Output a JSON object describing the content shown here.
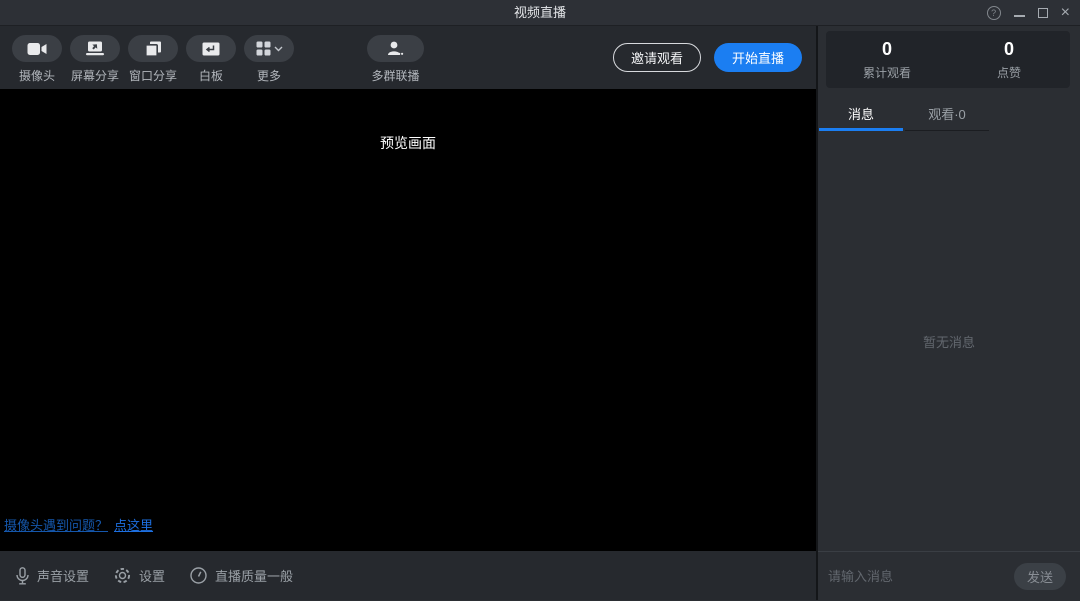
{
  "window": {
    "title": "视频直播"
  },
  "toolbar": {
    "tools": [
      {
        "label": "摄像头",
        "icon": "camera-icon"
      },
      {
        "label": "屏幕分享",
        "icon": "screen-share-icon"
      },
      {
        "label": "窗口分享",
        "icon": "window-share-icon"
      },
      {
        "label": "白板",
        "icon": "whiteboard-icon"
      },
      {
        "label": "更多",
        "icon": "more-grid-icon"
      },
      {
        "label": "多群联播",
        "icon": "multi-group-icon"
      }
    ],
    "invite_button": "邀请观看",
    "start_button": "开始直播"
  },
  "preview": {
    "label": "预览画面",
    "camera_help_question": "摄像头遇到问题？",
    "camera_help_link": "点这里"
  },
  "statusbar": {
    "sound_label": "声音设置",
    "settings_label": "设置",
    "quality_label": "直播质量一般"
  },
  "panel": {
    "stats": [
      {
        "value": "0",
        "label": "累计观看"
      },
      {
        "value": "0",
        "label": "点赞"
      }
    ],
    "tabs": [
      {
        "label": "消息"
      },
      {
        "label": "观看·0"
      }
    ],
    "empty_message": "暂无消息",
    "input_placeholder": "请输入消息",
    "send_button": "发送"
  },
  "icons": {
    "help_glyph": "?",
    "close_glyph": "×"
  },
  "colors": {
    "accent_blue": "#1b7ef2",
    "titlebar_bg": "#2d3036",
    "toolbar_bg": "#26292e",
    "panel_bg": "#2b2e33",
    "stats_box_bg": "#212429",
    "preview_bg": "#000000",
    "link_dark_blue": "#1557ac",
    "link_bright_blue": "#1d6fe0"
  }
}
